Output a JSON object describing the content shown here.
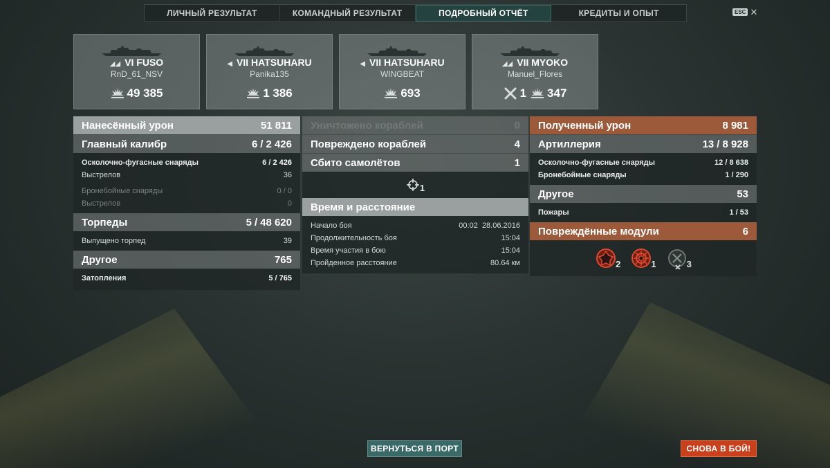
{
  "tabs": [
    {
      "label": "ЛИЧНЫЙ РЕЗУЛЬТАТ",
      "active": false
    },
    {
      "label": "КОМАНДНЫЙ РЕЗУЛЬТАТ",
      "active": false
    },
    {
      "label": "ПОДРОБНЫЙ ОТЧЁТ",
      "active": true
    },
    {
      "label": "КРЕДИТЫ И ОПЫТ",
      "active": false
    }
  ],
  "esc_label": "ESC",
  "ships": [
    {
      "tier_name": "VI FUSO",
      "player": "RnD_61_NSV",
      "damage": "49 385"
    },
    {
      "tier_name": "VII HATSUHARU",
      "player": "Panika135",
      "damage": "1 386"
    },
    {
      "tier_name": "VII HATSUHARU",
      "player": "WINGBEAT",
      "damage": "693"
    },
    {
      "tier_name": "VII MYOKO",
      "player": "Manuel_Flores",
      "kills": "1",
      "damage": "347"
    }
  ],
  "dealt": {
    "header": {
      "label": "Нанесённый урон",
      "value": "51 811"
    },
    "main_battery": {
      "label": "Главный калибр",
      "hits": "6",
      "value": "2 426"
    },
    "he": {
      "label": "Осколочно-фугасные снаряды",
      "hits": "6",
      "value": "2 426"
    },
    "he_shots": {
      "label": "Выстрелов",
      "value": "36"
    },
    "ap": {
      "label": "Бронебойные снаряды",
      "hits": "0",
      "value": "0"
    },
    "ap_shots": {
      "label": "Выстрелов",
      "value": "0"
    },
    "torpedoes": {
      "label": "Торпеды",
      "hits": "5",
      "value": "48 620"
    },
    "torp_launched": {
      "label": "Выпущено торпед",
      "value": "39"
    },
    "other": {
      "label": "Другое",
      "value": "765"
    },
    "flooding": {
      "label": "Затопления",
      "hits": "5",
      "value": "765"
    }
  },
  "middle": {
    "destroyed": {
      "label": "Уничтожено кораблей",
      "value": "0"
    },
    "damaged": {
      "label": "Повреждено кораблей",
      "value": "4"
    },
    "planes": {
      "label": "Сбито самолётов",
      "value": "1"
    },
    "crosshair_count": "1",
    "time_header": "Время и расстояние",
    "battle_start": {
      "label": "Начало боя",
      "time": "00:02",
      "date": "28.06.2016"
    },
    "duration": {
      "label": "Продолжительность боя",
      "value": "15:04"
    },
    "participation": {
      "label": "Время участия в бою",
      "value": "15:04"
    },
    "distance": {
      "label": "Пройденное расстояние",
      "value": "80.64 км"
    }
  },
  "received": {
    "header": {
      "label": "Полученный урон",
      "value": "8 981"
    },
    "artillery": {
      "label": "Артиллерия",
      "hits": "13",
      "value": "8 928"
    },
    "he": {
      "label": "Осколочно-фугасные снаряды",
      "hits": "12",
      "value": "8 638"
    },
    "ap": {
      "label": "Бронебойные снаряды",
      "hits": "1",
      "value": "290"
    },
    "other": {
      "label": "Другое",
      "value": "53"
    },
    "fires": {
      "label": "Пожары",
      "hits": "1",
      "value": "53"
    },
    "modules": {
      "label": "Повреждённые модули",
      "value": "6"
    },
    "module_icons": [
      {
        "name": "engine-module-icon",
        "count": "2"
      },
      {
        "name": "steering-module-icon",
        "count": "1"
      },
      {
        "name": "destroyed-module-icon",
        "count": "3"
      }
    ]
  },
  "buttons": {
    "port": "ВЕРНУТЬСЯ В ПОРТ",
    "battle": "СНОВА В БОЙ!"
  },
  "colors": {
    "accent_teal": "#24423f",
    "received_header": "#9c5a3b",
    "battle_button": "#c8401c",
    "port_button": "#3a6a68",
    "module_icon_red": "#c0392b"
  }
}
